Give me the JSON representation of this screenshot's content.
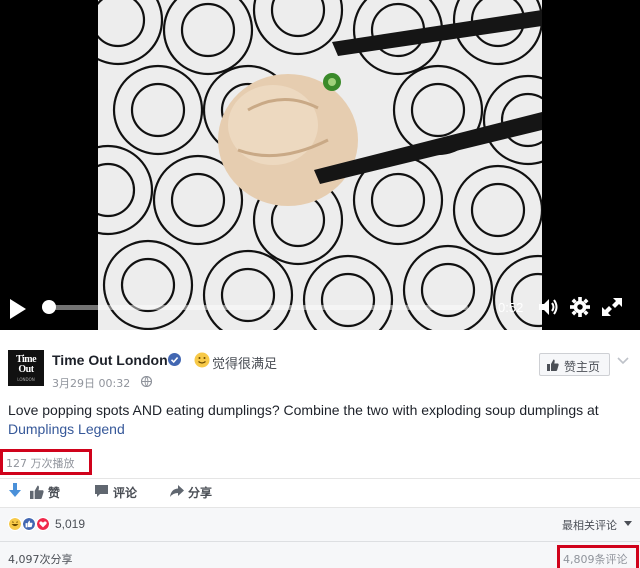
{
  "video": {
    "time": "0:52",
    "progress": 0.0,
    "scene": "dumpling-on-plate"
  },
  "post": {
    "page_name": "Time Out London",
    "avatar_logo": "Time Out",
    "avatar_sub": "LONDON",
    "feeling": "觉得很满足",
    "timestamp": "3月29日 00:32",
    "like_page_label": "赞主页",
    "caption_text": "Love popping spots AND eating dumplings? Combine the two with exploding soup dumplings at ",
    "caption_link": "Dumplings Legend",
    "views": "127 万次播放"
  },
  "actions": {
    "like": "赞",
    "comment": "评论",
    "share": "分享"
  },
  "stats": {
    "reactions_count": "5,019",
    "sort_label": "最相关评论",
    "shares": "4,097次分享",
    "comments": "4,809条评论"
  },
  "colors": {
    "link": "#365899",
    "highlight_box": "#d0021b",
    "verified": "#4267b2"
  }
}
